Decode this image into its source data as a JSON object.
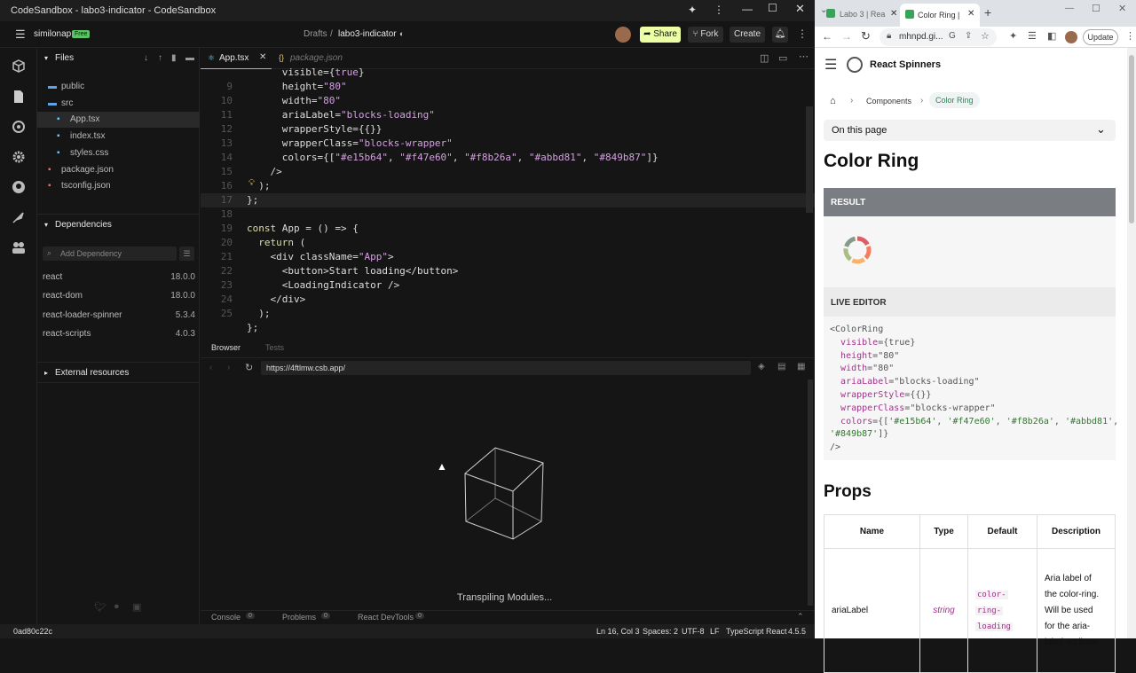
{
  "window": {
    "title": "CodeSandbox - labo3-indicator - CodeSandbox"
  },
  "topbar": {
    "user": "similonap",
    "plan": "Free",
    "drafts": "Drafts",
    "separator": "/",
    "project": "labo3-indicator",
    "share": "Share",
    "fork": "Fork",
    "create": "Create"
  },
  "sidebar": {
    "files_header": "Files",
    "files": [
      {
        "name": "public",
        "icon": "folder-icon",
        "indent": 1
      },
      {
        "name": "src",
        "icon": "folder-icon",
        "indent": 1
      },
      {
        "name": "App.tsx",
        "icon": "tsx-file-icon",
        "indent": 2
      },
      {
        "name": "index.tsx",
        "icon": "tsx-file-icon",
        "indent": 2
      },
      {
        "name": "styles.css",
        "icon": "css-file-icon",
        "indent": 2
      },
      {
        "name": "package.json",
        "icon": "json-file-icon",
        "indent": 1
      },
      {
        "name": "tsconfig.json",
        "icon": "json-file-icon",
        "indent": 1
      }
    ],
    "deps_header": "Dependencies",
    "add_dependency_placeholder": "Add Dependency",
    "dependencies": [
      {
        "name": "react",
        "version": "18.0.0"
      },
      {
        "name": "react-dom",
        "version": "18.0.0"
      },
      {
        "name": "react-loader-spinner",
        "version": "5.3.4"
      },
      {
        "name": "react-scripts",
        "version": "4.0.3"
      }
    ],
    "external_header": "External resources"
  },
  "editor": {
    "tabs": [
      {
        "label": "App.tsx",
        "active": true
      },
      {
        "label": "package.json",
        "active": false
      }
    ],
    "line_numbers": [
      "",
      "9",
      "10",
      "11",
      "12",
      "13",
      "14",
      "15",
      "16",
      "17",
      "18",
      "19",
      "20",
      "21",
      "22",
      "23",
      "24",
      "25"
    ],
    "lines": [
      "      visible={true}",
      "      height=\"80\"",
      "      width=\"80\"",
      "      ariaLabel=\"blocks-loading\"",
      "      wrapperStyle={{}}",
      "      wrapperClass=\"blocks-wrapper\"",
      "      colors={[\"#e15b64\", \"#f47e60\", \"#f8b26a\", \"#abbd81\", \"#849b87\"]}",
      "    />",
      "  );",
      "};",
      "",
      "const App = () => {",
      "  return (",
      "    <div className=\"App\">",
      "      <button>Start loading</button>",
      "      <LoadingIndicator />",
      "    </div>",
      "  );",
      "};"
    ]
  },
  "browser": {
    "tab_browser": "Browser",
    "tab_tests": "Tests",
    "url": "https://4ftlmw.csb.app/",
    "loading_text": "Transpiling Modules..."
  },
  "bottom": {
    "console": "Console",
    "console_count": "0",
    "problems": "Problems",
    "problems_count": "0",
    "devtools": "React DevTools",
    "devtools_count": "0"
  },
  "status": {
    "hash": "0ad80c22c",
    "position": "Ln 16, Col 3",
    "spaces": "Spaces: 2",
    "encoding": "UTF-8",
    "eol": "LF",
    "language": "TypeScript React",
    "version": "4.5.5"
  },
  "chrome": {
    "tabs": [
      {
        "label": "Labo 3 | Rea"
      },
      {
        "label": "Color Ring |"
      }
    ],
    "address": "mhnpd.gi...",
    "update": "Update"
  },
  "docs": {
    "site_title": "React Spinners",
    "breadcrumb": [
      "Components",
      "Color Ring"
    ],
    "on_this_page": "On this page",
    "heading": "Color Ring",
    "result_label": "RESULT",
    "live_editor_label": "LIVE EDITOR",
    "code_lines": [
      "<ColorRing",
      "  visible={true}",
      "  height=\"80\"",
      "  width=\"80\"",
      "  ariaLabel=\"blocks-loading\"",
      "  wrapperStyle={{}}",
      "  wrapperClass=\"blocks-wrapper\"",
      "  colors={['#e15b64', '#f47e60', '#f8b26a', '#abbd81',",
      "'#849b87']}",
      "/>"
    ],
    "props_heading": "Props",
    "table_headers": [
      "Name",
      "Type",
      "Default",
      "Description"
    ],
    "row": {
      "name": "ariaLabel",
      "type": "string",
      "default_lines": [
        "color-",
        "ring-",
        "loading"
      ],
      "description_lines": [
        "Aria label of",
        "the color-ring.",
        "Will be used",
        "for the aria-",
        "label attribute"
      ]
    },
    "ring_colors": [
      "#e15b64",
      "#f47e60",
      "#f8b26a",
      "#abbd81",
      "#849b87"
    ]
  }
}
